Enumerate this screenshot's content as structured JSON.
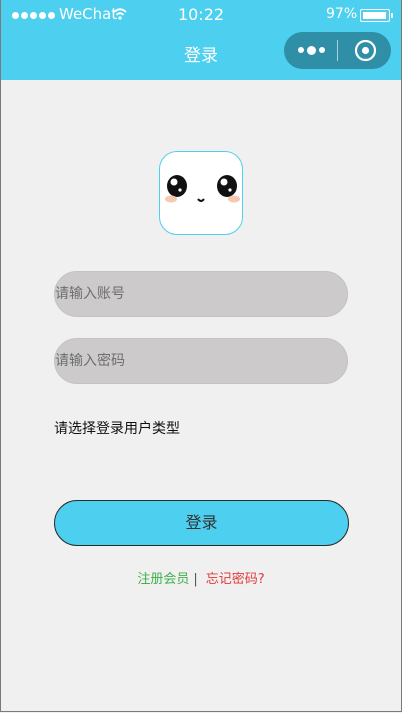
{
  "status_bar": {
    "carrier": "WeChat",
    "time": "10:22",
    "battery": "97%",
    "battery_level": 0.97
  },
  "nav": {
    "title": "登录",
    "more_icon": "more-dots-icon",
    "close_icon": "mini-program-close-icon"
  },
  "colors": {
    "accent": "#4dd0ef",
    "capsule": "#2e8fa7",
    "background": "#f1f0f0",
    "input_bg": "#cccaca",
    "register_link": "#3fb04a",
    "forgot_link": "#e03a3a"
  },
  "avatar": {
    "icon": "cute-face-logo"
  },
  "form": {
    "account_placeholder": "请输入账号",
    "password_placeholder": "请输入密码",
    "user_type_label": "请选择登录用户类型",
    "login_button": "登录"
  },
  "links": {
    "register": "注册会员",
    "separator": "|",
    "forgot": "忘记密码?"
  }
}
